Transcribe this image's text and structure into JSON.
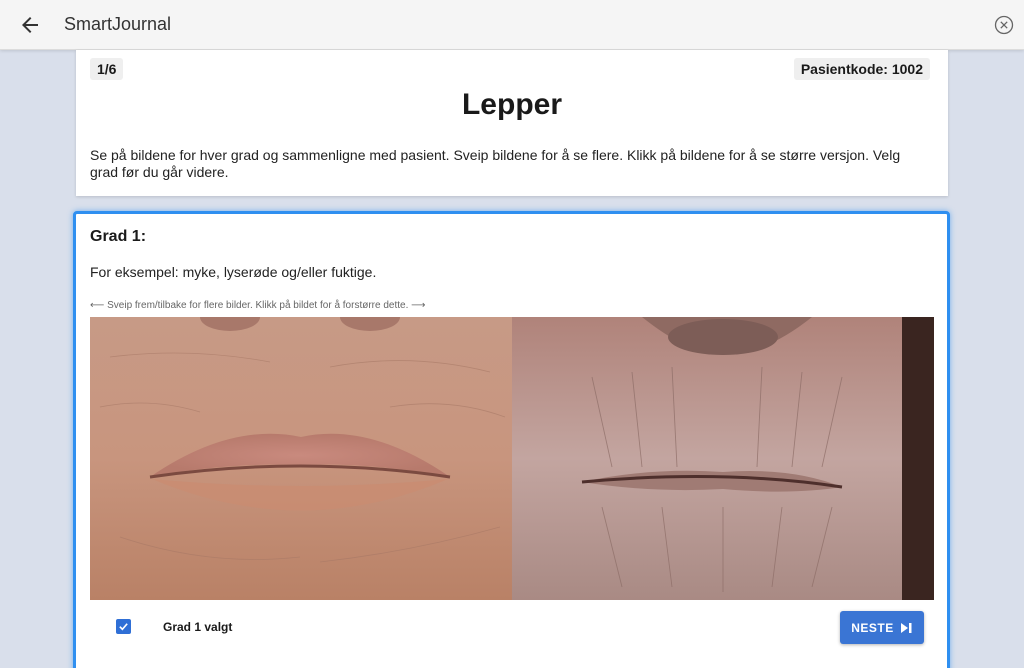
{
  "header": {
    "title": "SmartJournal",
    "back_icon": "arrow-left-icon",
    "close_icon": "close-circle-icon"
  },
  "intro": {
    "step": "1/6",
    "patient_code": "Pasientkode: 1002",
    "title": "Lepper",
    "instructions": "Se på bildene for hver grad og sammenligne med pasient. Sveip bildene for å se flere. Klikk på bildene for å se større versjon. Velg grad før du går videre."
  },
  "grade": {
    "title": "Grad 1:",
    "description": "For eksempel: myke, lyserøde og/eller fuktige.",
    "swipe_hint": "⟵ Sveip frem/tilbake for flere bilder. Klikk på bildet for å forstørre dette. ⟶",
    "selected_label": "Grad 1 valgt",
    "selected": true,
    "next_label": "NESTE",
    "next_icon": "skip-next-icon"
  },
  "colors": {
    "accent": "#2f8ff0",
    "button": "#3a75d4"
  }
}
